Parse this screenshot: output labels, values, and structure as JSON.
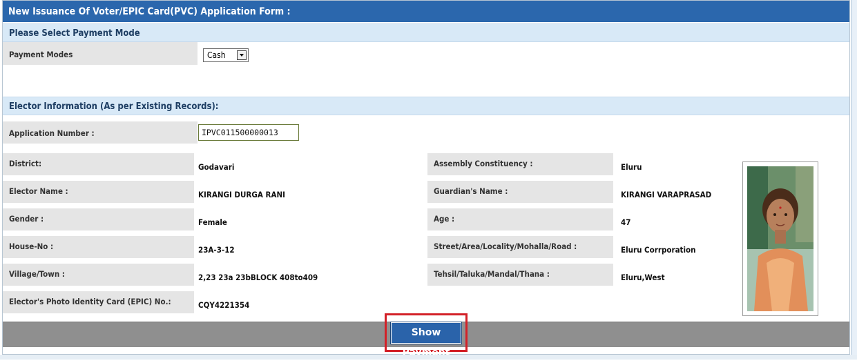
{
  "form": {
    "title": "New Issuance Of Voter/EPIC Card(PVC) Application Form :",
    "payment_section": "Please Select Payment Mode",
    "payment_label": "Payment Modes",
    "payment_value": "Cash",
    "elector_section": "Elector Information (As per Existing Records):",
    "application_label": "Application Number :",
    "application_value": "IPVC011500000013",
    "fields": {
      "district_label": "District:",
      "district_value": "Godavari",
      "ac_label": "Assembly Constituency :",
      "ac_value": "Eluru",
      "elector_name_label": "Elector Name :",
      "elector_name_value": "KIRANGI DURGA RANI",
      "guardian_label": "Guardian's  Name :",
      "guardian_value": "KIRANGI VARAPRASAD",
      "gender_label": "Gender :",
      "gender_value": "Female",
      "age_label": "Age :",
      "age_value": "47",
      "house_label": "House-No :",
      "house_value": "23A-3-12",
      "street_label": "Street/Area/Locality/Mohalla/Road :",
      "street_value": "Eluru Corrporation",
      "village_label": "Village/Town :",
      "village_value": "2,23 23a 23bBLOCK 408to409",
      "tehsil_label": "Tehsil/Taluka/Mandal/Thana :",
      "tehsil_value": "Eluru,West",
      "epic_label": "Elector's Photo Identity Card (EPIC) No.:",
      "epic_value": "CQY4221354"
    },
    "show_payment_label": "Show Payment"
  },
  "colors": {
    "header_blue": "#2b67ad",
    "section_blue": "#d8e9f7",
    "label_grey": "#e5e5e5",
    "footer_grey": "#8f8f8f",
    "highlight_red": "#d32027"
  },
  "icons": {
    "dropdown": "chevron-down-icon",
    "photo": "elector-photo"
  }
}
